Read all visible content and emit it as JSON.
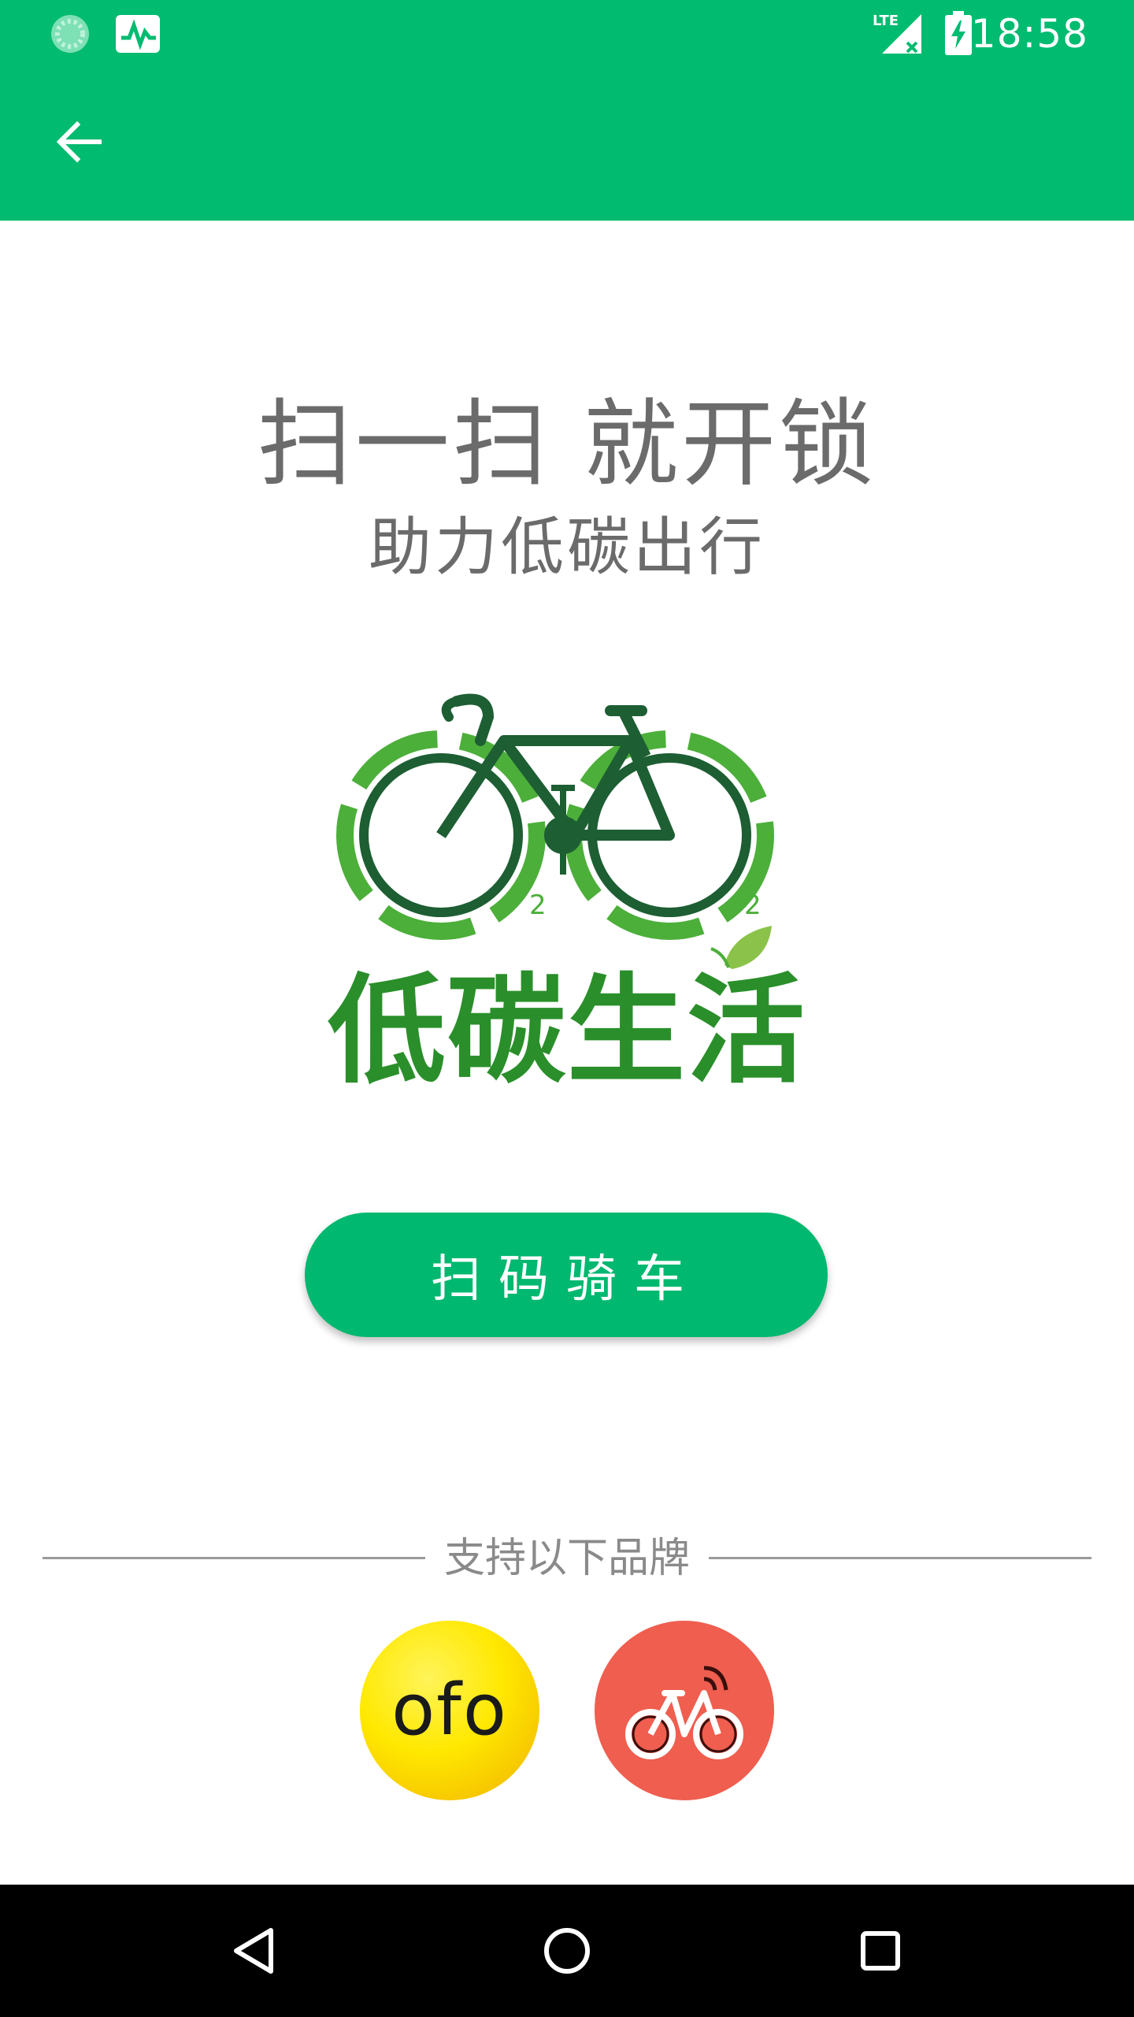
{
  "status_bar": {
    "time": "18:58",
    "network": "LTE",
    "icons": [
      "sync-icon",
      "activity-icon",
      "signal-icon",
      "battery-charging-icon"
    ]
  },
  "toolbar": {
    "back_icon": "arrow-left-icon"
  },
  "hero": {
    "headline": "扫一扫 就开锁",
    "subline": "助力低碳出行"
  },
  "logo": {
    "text": "低碳生活",
    "subscripts": [
      "2",
      "2"
    ]
  },
  "actions": {
    "scan_label": "扫码骑车"
  },
  "brands": {
    "label": "支持以下品牌",
    "items": [
      {
        "name": "ofo",
        "color": "#ffe800"
      },
      {
        "name": "mobike-icon",
        "color": "#ef5e4f"
      }
    ]
  },
  "nav": {
    "buttons": [
      "back-triangle-icon",
      "home-circle-icon",
      "recents-square-icon"
    ]
  },
  "colors": {
    "primary": "#00bb70",
    "text_gray": "#6b6b6b",
    "logo_green": "#2a8f2a",
    "logo_dark": "#1d5e33"
  }
}
